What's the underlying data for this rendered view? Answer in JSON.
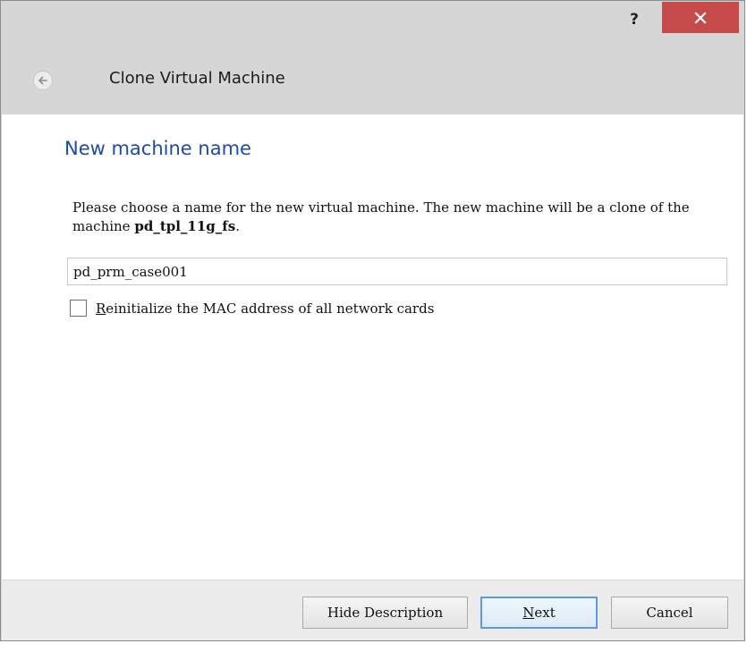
{
  "window": {
    "help_label": "?",
    "close_label": "close"
  },
  "header": {
    "title": "Clone Virtual Machine"
  },
  "page": {
    "title": "New machine name",
    "description_prefix": "Please choose a name for the new virtual machine. The new machine will be a clone of the machine ",
    "source_machine": "pd_tpl_11g_fs",
    "description_suffix": "."
  },
  "name_input": {
    "value": "pd_prm_case001"
  },
  "mac_checkbox": {
    "checked": false,
    "label_mnemonic": "R",
    "label_rest": "einitialize the MAC address of all network cards"
  },
  "footer": {
    "hide_description_label": "Hide Description",
    "next_mnemonic": "N",
    "next_rest": "ext",
    "cancel_label": "Cancel"
  },
  "icons": {
    "back": "back-arrow-icon",
    "close": "close-icon"
  },
  "colors": {
    "close_button": "#c74a4a",
    "page_title": "#1e4aa8",
    "default_button_border": "#5d9be0"
  }
}
